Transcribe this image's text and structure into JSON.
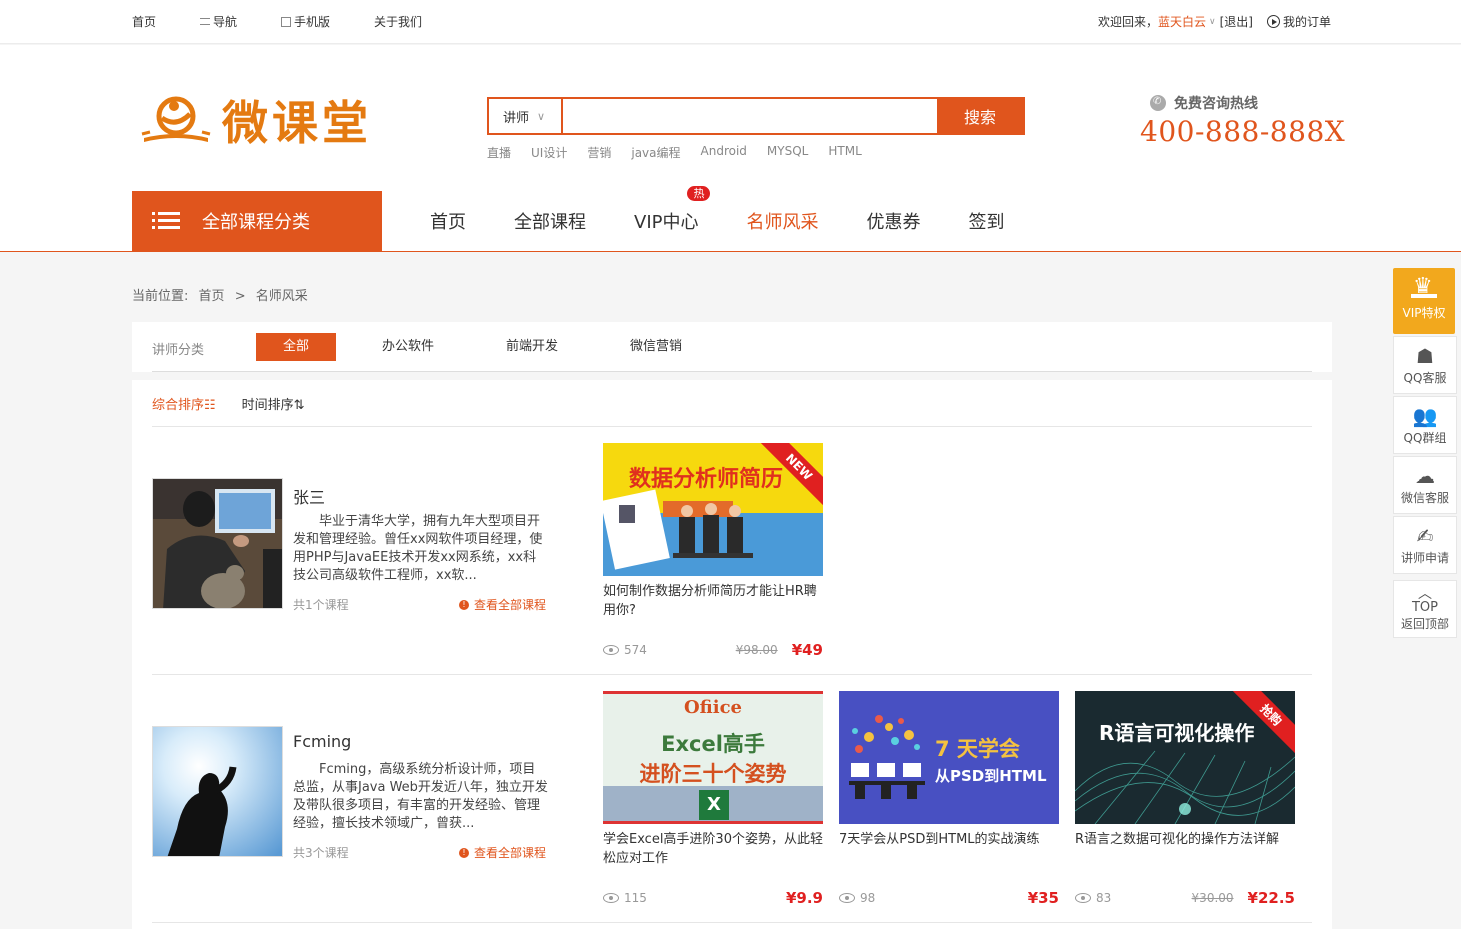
{
  "topbar": {
    "links": [
      "首页",
      "导航",
      "手机版",
      "关于我们"
    ],
    "welcome": "欢迎回来，",
    "username": "蓝天白云",
    "logout": "[退出]",
    "orders": "我的订单"
  },
  "header": {
    "logo_text": "微课堂",
    "search": {
      "category": "讲师",
      "placeholder": "",
      "button": "搜索"
    },
    "hot_words": [
      "直播",
      "UI设计",
      "营销",
      "java编程",
      "Android",
      "MYSQL",
      "HTML"
    ],
    "hotline_label": "免费咨询热线",
    "phone": "400-888-888X"
  },
  "nav": {
    "all_categories": "全部课程分类",
    "items": [
      "首页",
      "全部课程",
      "VIP中心",
      "名师风采",
      "优惠券",
      "签到"
    ],
    "hot_badge": "热",
    "active": "名师风采"
  },
  "breadcrumb": {
    "label": "当前位置:",
    "home": "首页",
    "sep": ">",
    "current": "名师风采"
  },
  "filter": {
    "label": "讲师分类",
    "options": [
      "全部",
      "办公软件",
      "前端开发",
      "微信营销"
    ]
  },
  "sort": {
    "options": [
      "综合排序☷",
      "时间排序⇅"
    ]
  },
  "teachers": [
    {
      "name": "张三",
      "desc": "毕业于清华大学，拥有九年大型项目开发和管理经验。曾任xx网软件项目经理，使用PHP与JavaEE技术开发xx网系统，xx科技公司高级软件工程师，xx软...",
      "count": "共1个课程",
      "view_all": "查看全部课程",
      "courses": [
        {
          "thumb_text": "数据分析师简历",
          "ribbon": "NEW",
          "title": "如何制作数据分析师简历才能让HR聘用你?",
          "views": "574",
          "old_price": "¥98.00",
          "price": "¥49"
        }
      ]
    },
    {
      "name": "Fcming",
      "desc": "Fcming，高级系统分析设计师，项目总监，从事Java Web开发近八年，独立开发及带队很多项目，有丰富的开发经验、管理经验，擅长技术领域广，曾获...",
      "count": "共3个课程",
      "view_all": "查看全部课程",
      "courses": [
        {
          "thumb_text_1": "Ofiice",
          "thumb_text_2": "Excel高手",
          "thumb_text_3": "进阶三十个姿势",
          "title": "学会Excel高手进阶30个姿势，从此轻松应对工作",
          "views": "115",
          "old_price": "",
          "price": "¥9.9"
        },
        {
          "thumb_text_1": "7 天学会",
          "thumb_text_2": "从PSD到HTML",
          "title": "7天学会从PSD到HTML的实战演练",
          "views": "98",
          "old_price": "",
          "price": "¥35"
        },
        {
          "thumb_text": "R语言可视化操作",
          "ribbon": "抢购",
          "title": "R语言之数据可视化的操作方法详解",
          "views": "83",
          "old_price": "¥30.00",
          "price": "¥22.5"
        }
      ]
    }
  ],
  "side": {
    "vip": "VIP特权",
    "items": [
      "QQ客服",
      "QQ群组",
      "微信客服",
      "讲师申请"
    ],
    "top_glyph": "TOP",
    "top_label": "返回顶部"
  },
  "colors": {
    "accent": "#e0551d",
    "logo": "#e47a11",
    "price": "#e02020",
    "vip": "#f2a81d"
  }
}
